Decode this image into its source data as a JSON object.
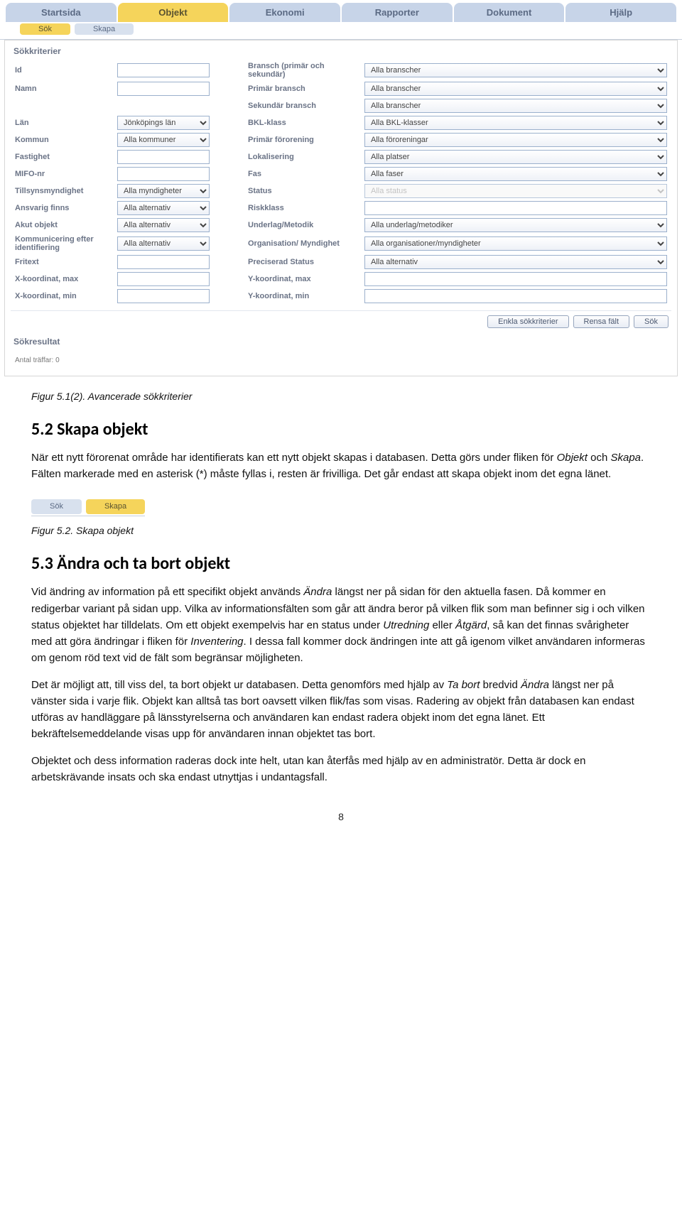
{
  "topnav": {
    "tabs": [
      "Startsida",
      "Objekt",
      "Ekonomi",
      "Rapporter",
      "Dokument",
      "Hjälp"
    ],
    "active_index": 1
  },
  "subnav": {
    "items": [
      "Sök",
      "Skapa"
    ],
    "active_index": 0
  },
  "section_title": "Sökkriterier",
  "left_rows": [
    {
      "label": "Id",
      "type": "text",
      "value": ""
    },
    {
      "label": "Namn",
      "type": "text",
      "value": ""
    },
    {
      "label": "",
      "type": "spacer"
    },
    {
      "label": "Län",
      "type": "select",
      "value": "Jönköpings län"
    },
    {
      "label": "Kommun",
      "type": "select",
      "value": "Alla kommuner"
    },
    {
      "label": "Fastighet",
      "type": "text",
      "value": ""
    },
    {
      "label": "MIFO-nr",
      "type": "text",
      "value": ""
    },
    {
      "label": "Tillsynsmyndighet",
      "type": "select",
      "value": "Alla myndigheter"
    },
    {
      "label": "Ansvarig finns",
      "type": "select",
      "value": "Alla alternativ"
    },
    {
      "label": "Akut objekt",
      "type": "select",
      "value": "Alla alternativ"
    },
    {
      "label": "Kommunicering efter identifiering",
      "type": "select",
      "value": "Alla alternativ"
    },
    {
      "label": "Fritext",
      "type": "text",
      "value": ""
    },
    {
      "label": "X-koordinat, max",
      "type": "text",
      "value": ""
    },
    {
      "label": "X-koordinat, min",
      "type": "text",
      "value": ""
    }
  ],
  "right_rows": [
    {
      "label": "Bransch (primär och sekundär)",
      "type": "select",
      "value": "Alla branscher"
    },
    {
      "label": "Primär bransch",
      "type": "select",
      "value": "Alla branscher"
    },
    {
      "label": "Sekundär bransch",
      "type": "select",
      "value": "Alla branscher"
    },
    {
      "label": "BKL-klass",
      "type": "select",
      "value": "Alla BKL-klasser"
    },
    {
      "label": "Primär förorening",
      "type": "select",
      "value": "Alla föroreningar"
    },
    {
      "label": "Lokalisering",
      "type": "select",
      "value": "Alla platser"
    },
    {
      "label": "Fas",
      "type": "select",
      "value": "Alla faser"
    },
    {
      "label": "Status",
      "type": "select",
      "value": "Alla status",
      "disabled": true
    },
    {
      "label": "Riskklass",
      "type": "text",
      "value": ""
    },
    {
      "label": "Underlag/Metodik",
      "type": "select",
      "value": "Alla underlag/metodiker"
    },
    {
      "label": "Organisation/ Myndighet",
      "type": "select",
      "value": "Alla organisationer/myndigheter"
    },
    {
      "label": "Preciserad Status",
      "type": "select",
      "value": "Alla alternativ"
    },
    {
      "label": "Y-koordinat, max",
      "type": "text",
      "value": ""
    },
    {
      "label": "Y-koordinat, min",
      "type": "text",
      "value": ""
    }
  ],
  "buttons": {
    "enkla": "Enkla sökkriterier",
    "rensa": "Rensa fält",
    "sok": "Sök"
  },
  "results_title": "Sökresultat",
  "hits_label": "Antal träffar: 0",
  "doc": {
    "caption1": "Figur 5.1(2). Avancerade sökkriterier",
    "h52": "5.2  Skapa objekt",
    "p52a": "När ett nytt förorenat område har identifierats kan ett nytt objekt skapas i databasen. Detta görs under fliken för ",
    "p52a_it1": "Objekt",
    "p52a_mid": " och ",
    "p52a_it2": "Skapa",
    "p52a_end": ". Fälten markerade med en asterisk (*) måste fyllas i, resten är frivilliga. Det går endast att skapa objekt inom det egna länet.",
    "fig_subnav": [
      "Sök",
      "Skapa"
    ],
    "caption2": "Figur 5.2. Skapa objekt",
    "h53": "5.3  Ändra och ta bort objekt",
    "p53_1a": "Vid ändring av information på ett specifikt objekt används ",
    "p53_1_it1": "Ändra",
    "p53_1b": " längst ner på sidan för den aktuella fasen. Då kommer en redigerbar variant på sidan upp. Vilka av informationsfälten som går att ändra beror på vilken flik som man befinner sig i och vilken status objektet har tilldelats. Om ett objekt exempelvis har en status under ",
    "p53_1_it2": "Utredning",
    "p53_1c": " eller ",
    "p53_1_it3": "Åtgärd",
    "p53_1d": ", så kan det finnas svårigheter med att göra ändringar i fliken för ",
    "p53_1_it4": "Inventering",
    "p53_1e": ". I dessa fall kommer dock ändringen inte att gå igenom vilket användaren informeras om genom röd text vid de fält som begränsar möjligheten.",
    "p53_2a": "Det är möjligt att, till viss del, ta bort objekt ur databasen. Detta genomförs med hjälp av ",
    "p53_2_it1": "Ta bort",
    "p53_2b": " bredvid ",
    "p53_2_it2": "Ändra",
    "p53_2c": " längst ner på vänster sida i varje flik. Objekt kan alltså tas bort oavsett vilken flik/fas som visas. Radering av objekt från databasen kan endast utföras av handläggare på länsstyrelserna och användaren kan endast radera objekt inom det egna länet. Ett bekräftelsemeddelande visas upp för användaren innan objektet tas bort.",
    "p53_3": "Objektet och dess information raderas dock inte helt, utan kan återfås med hjälp av en administratör. Detta är dock en arbetskrävande insats och ska endast utnyttjas i undantagsfall.",
    "pagenum": "8"
  }
}
